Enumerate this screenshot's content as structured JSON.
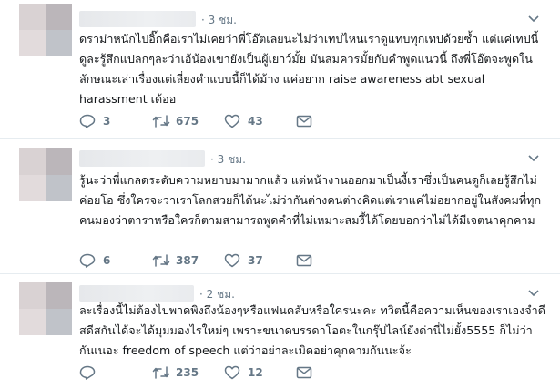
{
  "tweets": [
    {
      "time": "· 3 ชม.",
      "text": "ดราม่าหนักไปอิ๊กคือเราไม่เคยว่าพี่โอ๊ตเลยนะไม่ว่าเทปไหนเราดูแทบทุกเทปด้วยซ้ำ แต่แค่เทปนี้ดูละรู้สึกแปลกๆละว่าเอ้น้องเขายังเป็นผู้เยาว์มั้ย มันสมควรมั้ยกับคำพูดแนวนี้ ถึงพี่โอ๊ตจะพูดในลักษณะเล่าเรื่องแต่เลี่ยงคำแบบนี้ก็ได้ม้าง แค่อยาก raise awareness abt sexual harassment เด้ออ",
      "replies": "3",
      "retweets": "675",
      "likes": "43"
    },
    {
      "time": "· 3 ชม.",
      "text": "รู้นะว่าพี่แกลดระดับความหยาบมามากแล้ว แต่หน้างานออกมาเป็นงี้เราซึ่งเป็นคนดูก็เลยรู้สึกไม่ค่อยโอ ซึ่งใครจะว่าเราโลกสวยก็ได้นะไม่ว่ากันต่างคนต่างคิดแต่เราแค่ไม่อยากอยู่ในสังคมที่ทุกคนมองว่าตาราหรือใครก็ตามสามารถพูดคำที่ไม่เหมาะสมงี้ได้โดยบอกว่าไม่ได้มีเจตนาคุกคาม",
      "replies": "6",
      "retweets": "387",
      "likes": "37"
    },
    {
      "time": "· 2 ชม.",
      "text": "ละเรื่องนี้ไม่ต้องไปพาดพิงถึงน้องๆหรือแฟนคลับหรือใครนะคะ ทวิตนี้คือความเห็นของเราเองจำดีสดีสกันได้จะได้มุมมองไรใหม่ๆ เพราะขนาดบรรดาโอตะในกรุ๊ปไลน์ยังด่านี่ไม่ยั้ง5555 ก็ไม่ว่ากันเนอะ freedom of speech แต่ว่าอย่าละเมิดอย่าคุกคามกันนะจ้ะ",
      "replies": "",
      "retweets": "235",
      "likes": "12"
    }
  ],
  "icons": {
    "more": "chevron-down-icon",
    "reply": "reply-icon",
    "retweet": "retweet-icon",
    "like": "heart-icon",
    "dm": "message-icon"
  },
  "colors": {
    "secondary": "#657786",
    "text": "#14171a",
    "divider": "#e6ecf0"
  }
}
